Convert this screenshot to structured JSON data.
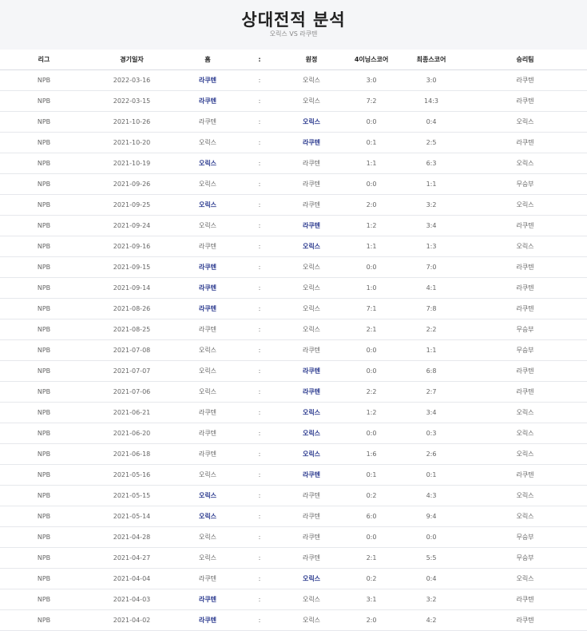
{
  "header": {
    "title": "상대전적 분석",
    "subtitle": "오릭스 VS 라쿠텐"
  },
  "table": {
    "columns": [
      "리그",
      "경기일자",
      "홈",
      ":",
      "원정",
      "4이닝스코어",
      "최종스코어",
      "승리팀"
    ],
    "rows": [
      {
        "league": "NPB",
        "date": "2022-03-16",
        "home": "라쿠텐",
        "sep": ":",
        "away": "오릭스",
        "score4": "3:0",
        "final": "3:0",
        "winner": "라쿠텐",
        "win": "home"
      },
      {
        "league": "NPB",
        "date": "2022-03-15",
        "home": "라쿠텐",
        "sep": ":",
        "away": "오릭스",
        "score4": "7:2",
        "final": "14:3",
        "winner": "라쿠텐",
        "win": "home"
      },
      {
        "league": "NPB",
        "date": "2021-10-26",
        "home": "라쿠텐",
        "sep": ":",
        "away": "오릭스",
        "score4": "0:0",
        "final": "0:4",
        "winner": "오릭스",
        "win": "away"
      },
      {
        "league": "NPB",
        "date": "2021-10-20",
        "home": "오릭스",
        "sep": ":",
        "away": "라쿠텐",
        "score4": "0:1",
        "final": "2:5",
        "winner": "라쿠텐",
        "win": "away"
      },
      {
        "league": "NPB",
        "date": "2021-10-19",
        "home": "오릭스",
        "sep": ":",
        "away": "라쿠텐",
        "score4": "1:1",
        "final": "6:3",
        "winner": "오릭스",
        "win": "home"
      },
      {
        "league": "NPB",
        "date": "2021-09-26",
        "home": "오릭스",
        "sep": ":",
        "away": "라쿠텐",
        "score4": "0:0",
        "final": "1:1",
        "winner": "무승부",
        "win": "none"
      },
      {
        "league": "NPB",
        "date": "2021-09-25",
        "home": "오릭스",
        "sep": ":",
        "away": "라쿠텐",
        "score4": "2:0",
        "final": "3:2",
        "winner": "오릭스",
        "win": "home"
      },
      {
        "league": "NPB",
        "date": "2021-09-24",
        "home": "오릭스",
        "sep": ":",
        "away": "라쿠텐",
        "score4": "1:2",
        "final": "3:4",
        "winner": "라쿠텐",
        "win": "away"
      },
      {
        "league": "NPB",
        "date": "2021-09-16",
        "home": "라쿠텐",
        "sep": ":",
        "away": "오릭스",
        "score4": "1:1",
        "final": "1:3",
        "winner": "오릭스",
        "win": "away"
      },
      {
        "league": "NPB",
        "date": "2021-09-15",
        "home": "라쿠텐",
        "sep": ":",
        "away": "오릭스",
        "score4": "0:0",
        "final": "7:0",
        "winner": "라쿠텐",
        "win": "home"
      },
      {
        "league": "NPB",
        "date": "2021-09-14",
        "home": "라쿠텐",
        "sep": ":",
        "away": "오릭스",
        "score4": "1:0",
        "final": "4:1",
        "winner": "라쿠텐",
        "win": "home"
      },
      {
        "league": "NPB",
        "date": "2021-08-26",
        "home": "라쿠텐",
        "sep": ":",
        "away": "오릭스",
        "score4": "7:1",
        "final": "7:8",
        "winner": "라쿠텐",
        "win": "home"
      },
      {
        "league": "NPB",
        "date": "2021-08-25",
        "home": "라쿠텐",
        "sep": ":",
        "away": "오릭스",
        "score4": "2:1",
        "final": "2:2",
        "winner": "무승부",
        "win": "none"
      },
      {
        "league": "NPB",
        "date": "2021-07-08",
        "home": "오릭스",
        "sep": ":",
        "away": "라쿠텐",
        "score4": "0:0",
        "final": "1:1",
        "winner": "무승부",
        "win": "none"
      },
      {
        "league": "NPB",
        "date": "2021-07-07",
        "home": "오릭스",
        "sep": ":",
        "away": "라쿠텐",
        "score4": "0:0",
        "final": "6:8",
        "winner": "라쿠텐",
        "win": "away"
      },
      {
        "league": "NPB",
        "date": "2021-07-06",
        "home": "오릭스",
        "sep": ":",
        "away": "라쿠텐",
        "score4": "2:2",
        "final": "2:7",
        "winner": "라쿠텐",
        "win": "away"
      },
      {
        "league": "NPB",
        "date": "2021-06-21",
        "home": "라쿠텐",
        "sep": ":",
        "away": "오릭스",
        "score4": "1:2",
        "final": "3:4",
        "winner": "오릭스",
        "win": "away"
      },
      {
        "league": "NPB",
        "date": "2021-06-20",
        "home": "라쿠텐",
        "sep": ":",
        "away": "오릭스",
        "score4": "0:0",
        "final": "0:3",
        "winner": "오릭스",
        "win": "away"
      },
      {
        "league": "NPB",
        "date": "2021-06-18",
        "home": "라쿠텐",
        "sep": ":",
        "away": "오릭스",
        "score4": "1:6",
        "final": "2:6",
        "winner": "오릭스",
        "win": "away"
      },
      {
        "league": "NPB",
        "date": "2021-05-16",
        "home": "오릭스",
        "sep": ":",
        "away": "라쿠텐",
        "score4": "0:1",
        "final": "0:1",
        "winner": "라쿠텐",
        "win": "away"
      },
      {
        "league": "NPB",
        "date": "2021-05-15",
        "home": "오릭스",
        "sep": ":",
        "away": "라쿠텐",
        "score4": "0:2",
        "final": "4:3",
        "winner": "오릭스",
        "win": "home"
      },
      {
        "league": "NPB",
        "date": "2021-05-14",
        "home": "오릭스",
        "sep": ":",
        "away": "라쿠텐",
        "score4": "6:0",
        "final": "9:4",
        "winner": "오릭스",
        "win": "home"
      },
      {
        "league": "NPB",
        "date": "2021-04-28",
        "home": "오릭스",
        "sep": ":",
        "away": "라쿠텐",
        "score4": "0:0",
        "final": "0:0",
        "winner": "무승부",
        "win": "none"
      },
      {
        "league": "NPB",
        "date": "2021-04-27",
        "home": "오릭스",
        "sep": ":",
        "away": "라쿠텐",
        "score4": "2:1",
        "final": "5:5",
        "winner": "무승부",
        "win": "none"
      },
      {
        "league": "NPB",
        "date": "2021-04-04",
        "home": "라쿠텐",
        "sep": ":",
        "away": "오릭스",
        "score4": "0:2",
        "final": "0:4",
        "winner": "오릭스",
        "win": "away"
      },
      {
        "league": "NPB",
        "date": "2021-04-03",
        "home": "라쿠텐",
        "sep": ":",
        "away": "오릭스",
        "score4": "3:1",
        "final": "3:2",
        "winner": "라쿠텐",
        "win": "home"
      },
      {
        "league": "NPB",
        "date": "2021-04-02",
        "home": "라쿠텐",
        "sep": ":",
        "away": "오릭스",
        "score4": "2:0",
        "final": "4:2",
        "winner": "라쿠텐",
        "win": "home"
      }
    ]
  },
  "colors": {
    "winner_text": "#2b3a8f",
    "normal_text": "#666666",
    "background": "#f5f6f8"
  }
}
